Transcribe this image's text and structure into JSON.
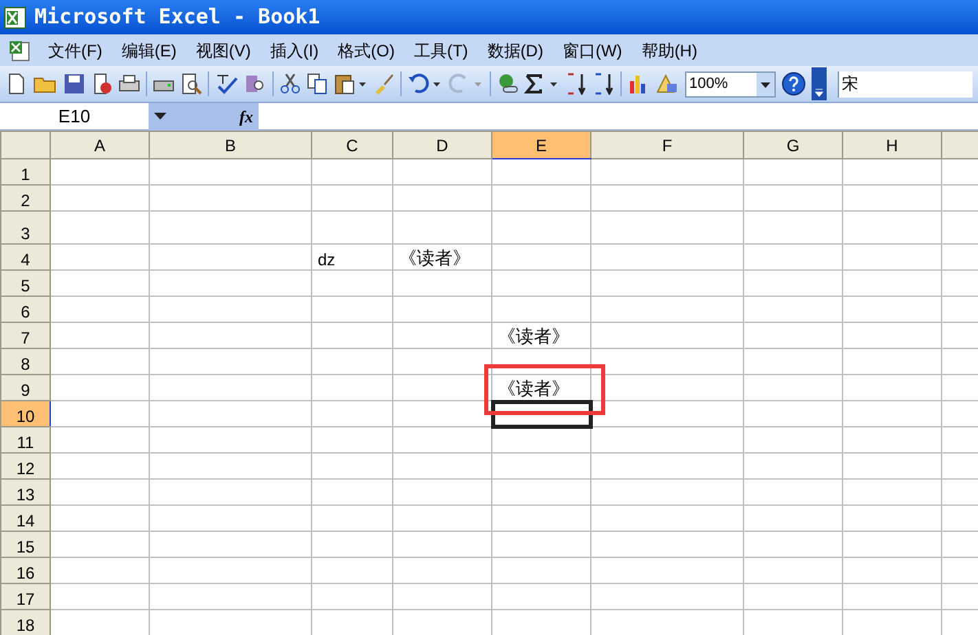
{
  "window": {
    "title": "Microsoft Excel - Book1"
  },
  "menu": [
    {
      "label": "文件(F)"
    },
    {
      "label": "编辑(E)"
    },
    {
      "label": "视图(V)"
    },
    {
      "label": "插入(I)"
    },
    {
      "label": "格式(O)"
    },
    {
      "label": "工具(T)"
    },
    {
      "label": "数据(D)"
    },
    {
      "label": "窗口(W)"
    },
    {
      "label": "帮助(H)"
    }
  ],
  "toolbar": {
    "zoom": "100%",
    "font": "宋"
  },
  "formula_bar": {
    "name_box": "E10",
    "fx": "fx"
  },
  "sheet": {
    "columns": [
      {
        "label": "A",
        "selected": false
      },
      {
        "label": "B",
        "selected": false
      },
      {
        "label": "C",
        "selected": false
      },
      {
        "label": "D",
        "selected": false
      },
      {
        "label": "E",
        "selected": true
      },
      {
        "label": "F",
        "selected": false
      },
      {
        "label": "G",
        "selected": false
      },
      {
        "label": "H",
        "selected": false
      }
    ],
    "rows": [
      {
        "label": "1",
        "selected": false,
        "cells": []
      },
      {
        "label": "2",
        "selected": false,
        "cells": []
      },
      {
        "label": "3",
        "selected": false,
        "cells": []
      },
      {
        "label": "4",
        "selected": false,
        "cells": [
          "",
          "",
          "dz",
          "《读者》"
        ]
      },
      {
        "label": "5",
        "selected": false,
        "cells": []
      },
      {
        "label": "6",
        "selected": false,
        "cells": []
      },
      {
        "label": "7",
        "selected": false,
        "cells": [
          "",
          "",
          "",
          "",
          "《读者》"
        ]
      },
      {
        "label": "8",
        "selected": false,
        "cells": []
      },
      {
        "label": "9",
        "selected": false,
        "cells": [
          "",
          "",
          "",
          "",
          "《读者》"
        ]
      },
      {
        "label": "10",
        "selected": true,
        "cells": []
      },
      {
        "label": "11",
        "selected": false,
        "cells": []
      },
      {
        "label": "12",
        "selected": false,
        "cells": []
      },
      {
        "label": "13",
        "selected": false,
        "cells": []
      },
      {
        "label": "14",
        "selected": false,
        "cells": []
      },
      {
        "label": "15",
        "selected": false,
        "cells": []
      },
      {
        "label": "16",
        "selected": false,
        "cells": []
      },
      {
        "label": "17",
        "selected": false,
        "cells": []
      },
      {
        "label": "18",
        "selected": false,
        "cells": []
      }
    ]
  }
}
